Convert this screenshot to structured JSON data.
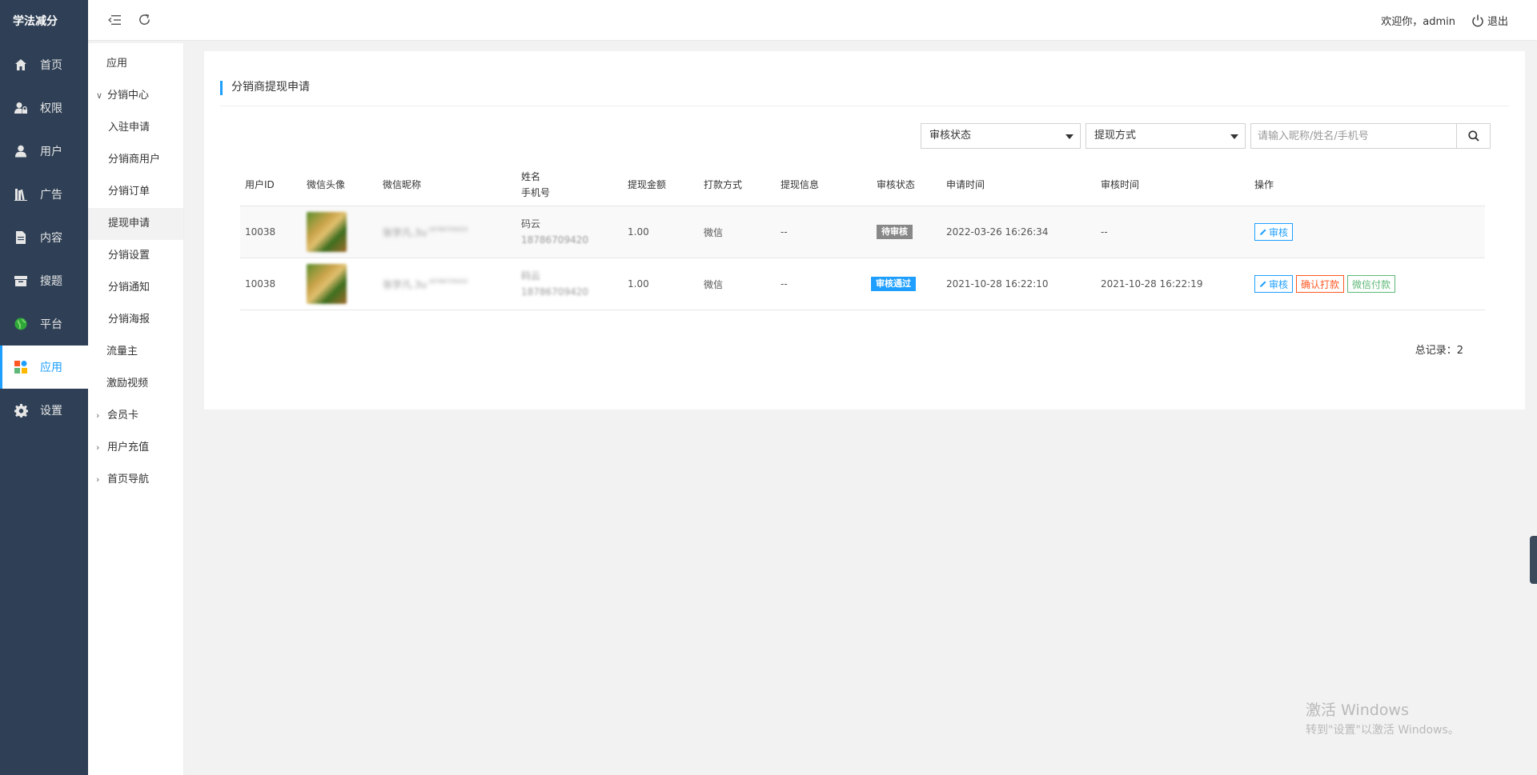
{
  "brand": "学法减分",
  "nav": [
    {
      "label": "首页",
      "icon": "home-icon"
    },
    {
      "label": "权限",
      "icon": "user-lock-icon"
    },
    {
      "label": "用户",
      "icon": "user-icon"
    },
    {
      "label": "广告",
      "icon": "books-icon"
    },
    {
      "label": "内容",
      "icon": "document-icon"
    },
    {
      "label": "搜题",
      "icon": "box-icon"
    },
    {
      "label": "平台",
      "icon": "globe-icon"
    },
    {
      "label": "应用",
      "icon": "apps-icon"
    },
    {
      "label": "设置",
      "icon": "gear-icon"
    }
  ],
  "subnav": {
    "title": "应用",
    "group_distribution": "分销中心",
    "children": [
      "入驻申请",
      "分销商用户",
      "分销订单",
      "提现申请",
      "分销设置",
      "分销通知",
      "分销海报"
    ],
    "items": [
      "流量主",
      "激励视频"
    ],
    "group_vip": "会员卡",
    "group_recharge": "用户充值",
    "group_home_nav": "首页导航"
  },
  "header": {
    "welcome": "欢迎你，admin",
    "logout": "退出"
  },
  "card": {
    "title": "分销商提现申请",
    "filter_status": "审核状态",
    "filter_method": "提现方式",
    "search_placeholder": "请输入昵称/姓名/手机号"
  },
  "table": {
    "headers": {
      "user_id": "用户ID",
      "avatar": "微信头像",
      "nickname": "微信昵称",
      "name": "姓名",
      "phone": "手机号",
      "amount": "提现金额",
      "pay_method": "打款方式",
      "info": "提现信息",
      "status": "审核状态",
      "apply_time": "申请时间",
      "audit_time": "审核时间",
      "actions": "操作"
    },
    "rows": [
      {
        "user_id": "10038",
        "nickname": "张学凡.3u",
        "nickname_sub": "18786709420",
        "name": "码云",
        "phone": "18786709420",
        "amount": "1.00",
        "pay_method": "微信",
        "info": "--",
        "status": "待审核",
        "apply_time": "2022-03-26 16:26:34",
        "audit_time": "--",
        "btn_audit": "审核"
      },
      {
        "user_id": "10038",
        "nickname": "张学凡.3u",
        "nickname_sub": "18786709420",
        "name": "码云",
        "phone": "18786709420",
        "amount": "1.00",
        "pay_method": "微信",
        "info": "--",
        "status": "审核通过",
        "apply_time": "2021-10-28 16:22:10",
        "audit_time": "2021-10-28 16:22:19",
        "btn_audit": "审核",
        "btn_confirm": "确认打款",
        "btn_wechat": "微信付款"
      }
    ]
  },
  "total": "总记录：2",
  "watermark": {
    "line1": "激活 Windows",
    "line2": "转到\"设置\"以激活 Windows。"
  },
  "colors": {
    "sidebar": "#2f4056",
    "accent": "#1e9fff",
    "danger": "#ff5722",
    "success": "#5fb878",
    "pending": "#888888"
  }
}
